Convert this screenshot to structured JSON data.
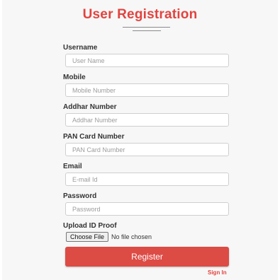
{
  "title": "User Registration",
  "fields": {
    "username": {
      "label": "Username",
      "placeholder": "User Name",
      "value": ""
    },
    "mobile": {
      "label": "Mobile",
      "placeholder": "Mobile Number",
      "value": ""
    },
    "addhar": {
      "label": "Addhar Number",
      "placeholder": "Addhar Number",
      "value": ""
    },
    "pan": {
      "label": "PAN Card Number",
      "placeholder": "PAN Card Number",
      "value": ""
    },
    "email": {
      "label": "Email",
      "placeholder": "E-mail Id",
      "value": ""
    },
    "password": {
      "label": "Password",
      "placeholder": "Password",
      "value": ""
    }
  },
  "upload": {
    "label": "Upload ID Proof",
    "button_label": "Choose File",
    "status": "No file chosen"
  },
  "register_label": "Register",
  "signin_label": "Sign In",
  "colors": {
    "accent": "#e2433f",
    "button": "#dd4b45",
    "background": "#f7f7f7"
  }
}
